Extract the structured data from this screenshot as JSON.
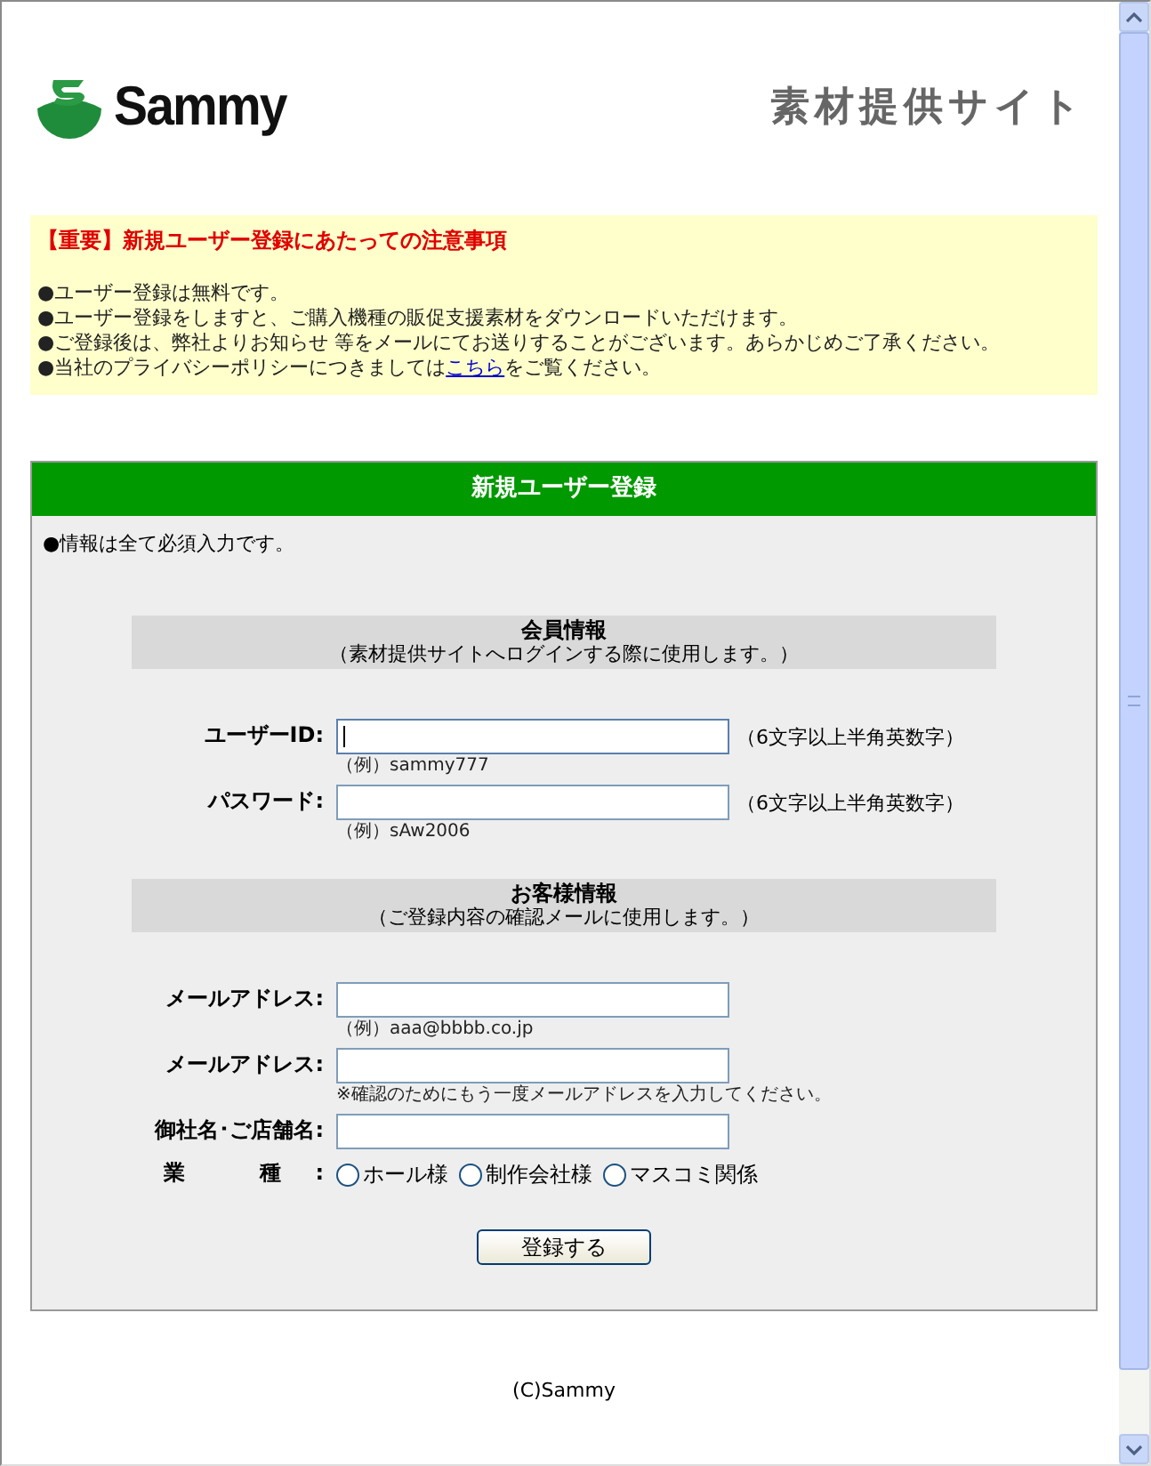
{
  "header": {
    "logo_text": "Sammy",
    "site_title": "素材提供サイト"
  },
  "notice": {
    "title": "【重要】新規ユーザー登録にあたっての注意事項",
    "items": [
      {
        "text": "●ユーザー登録は無料です。"
      },
      {
        "text": "●ユーザー登録をしますと、ご購入機種の販促支援素材をダウンロードいただけます。"
      },
      {
        "text": "●ご登録後は、弊社よりお知らせ 等をメールにてお送りすることがございます。あらかじめご了承ください。"
      },
      {
        "text": "●当社のプライバシーポリシーにつきましては",
        "link": "こちら",
        "after": "をご覧ください。"
      }
    ]
  },
  "form": {
    "title": "新規ユーザー登録",
    "note": "●情報は全て必須入力です。",
    "sections": [
      {
        "heading": "会員情報",
        "subheading": "（素材提供サイトへログインする際に使用します。）",
        "fields": [
          {
            "kind": "text",
            "label": "ユーザーID:",
            "focused": true,
            "hint": "（6文字以上半角英数字）",
            "example": "（例）sammy777"
          },
          {
            "kind": "text",
            "label": "パスワード:",
            "focused": false,
            "hint": "（6文字以上半角英数字）",
            "example": "（例）sAw2006"
          }
        ]
      },
      {
        "heading": "お客様情報",
        "subheading": "（ご登録内容の確認メールに使用します。）",
        "fields": [
          {
            "kind": "text",
            "label": "メールアドレス:",
            "focused": false,
            "example": "（例）aaa@bbbb.co.jp"
          },
          {
            "kind": "text",
            "label": "メールアドレス:",
            "focused": false,
            "example": "※確認のためにもう一度メールアドレスを入力してください。"
          },
          {
            "kind": "text",
            "label": "御社名･ご店舗名:",
            "focused": false
          },
          {
            "kind": "radio",
            "label": "業 種:",
            "options": [
              {
                "label": "ホール様",
                "selected": false
              },
              {
                "label": "制作会社様",
                "selected": false
              },
              {
                "label": "マスコミ関係",
                "selected": false
              }
            ]
          }
        ]
      }
    ],
    "submit": "登録する"
  },
  "footer": "(C)Sammy"
}
